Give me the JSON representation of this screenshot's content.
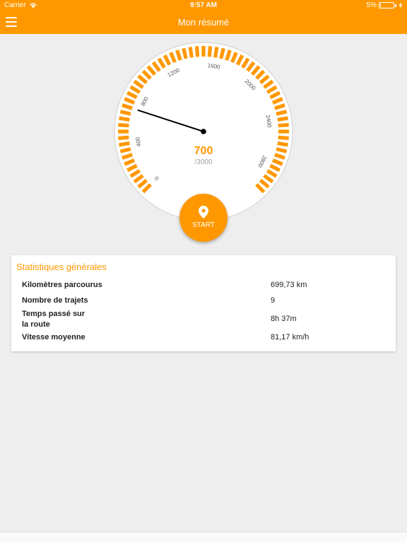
{
  "status_bar": {
    "carrier": "Carrier",
    "time": "9:57 AM",
    "battery_percent": "5%",
    "battery_level": 0.05,
    "wifi_icon": "wifi-icon",
    "battery_icon": "battery-icon",
    "charging_icon": "bolt-icon"
  },
  "app_bar": {
    "title": "Mon résumé",
    "menu_icon": "hamburger-icon"
  },
  "gauge": {
    "value": 700,
    "value_label": "700",
    "max_label": "/3000",
    "min": 0,
    "max": 3000,
    "ticks": [
      "0",
      "400",
      "800",
      "1200",
      "1600",
      "2000",
      "2400",
      "2800"
    ],
    "accent_color": "#ff9800"
  },
  "start_button": {
    "label": "START",
    "icon": "location-pin-icon"
  },
  "stats": {
    "title": "Statistiques générales",
    "rows": [
      {
        "label": "Kilomètres parcourus",
        "value": "699,73 km"
      },
      {
        "label": "Nombre de trajets",
        "value": "9"
      },
      {
        "label_line1": "Temps passé sur",
        "label_line2": "la route",
        "value": "8h 37m"
      },
      {
        "label": "Vitesse moyenne",
        "value": "81,17 km/h"
      }
    ]
  },
  "colors": {
    "primary": "#ff9800",
    "background": "#eeeeee"
  }
}
